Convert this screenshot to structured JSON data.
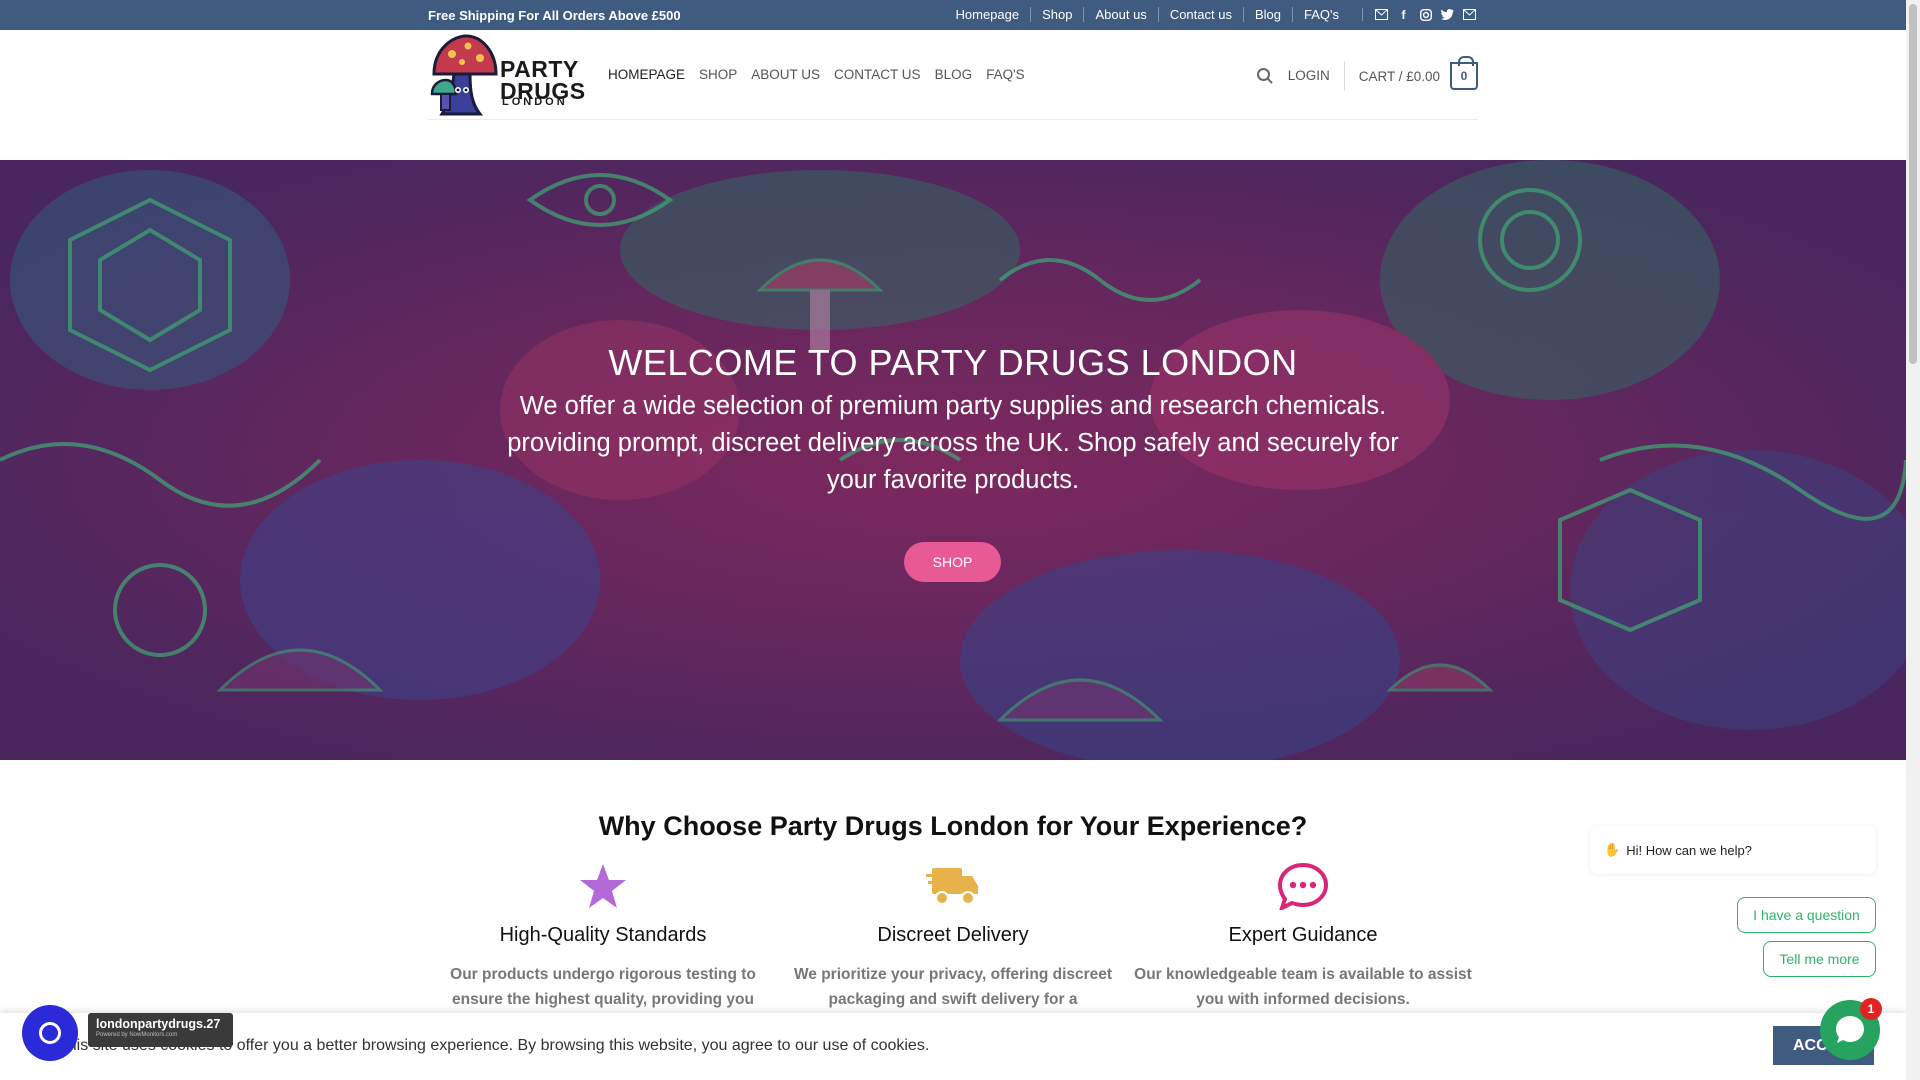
{
  "topbar": {
    "shipping": "Free Shipping For All Orders Above £500",
    "links": [
      "Homepage",
      "Shop",
      "About us",
      "Contact us",
      "Blog",
      "FAQ's"
    ],
    "social_icons": [
      "mail-icon",
      "facebook-icon",
      "instagram-icon",
      "twitter-icon",
      "mail-icon"
    ]
  },
  "header": {
    "logo_line1": "PARTY",
    "logo_line2": "DRUGS",
    "logo_line3": "LONDON",
    "nav": [
      "HOMEPAGE",
      "SHOP",
      "ABOUT US",
      "CONTACT US",
      "BLOG",
      "FAQ'S"
    ],
    "login": "LOGIN",
    "cart": "CART / £0.00",
    "cart_count": "0"
  },
  "hero": {
    "title": "WELCOME TO PARTY DRUGS LONDON",
    "text": "We offer a wide selection of premium party supplies and research chemicals. providing prompt, discreet delivery across the UK. Shop safely and securely for your favorite products.",
    "button": "SHOP"
  },
  "features": {
    "heading": "Why Choose Party Drugs London for Your Experience?",
    "items": [
      {
        "icon": "star-icon",
        "title": "High-Quality Standards",
        "text": "Our products undergo rigorous testing to ensure the highest quality, providing you"
      },
      {
        "icon": "delivery-truck-icon",
        "title": "Discreet Delivery",
        "text": "We prioritize your privacy, offering discreet packaging and swift delivery for a"
      },
      {
        "icon": "chat-bubble-icon",
        "title": "Expert Guidance",
        "text": "Our knowledgeable team is available to assist you with informed decisions."
      }
    ]
  },
  "cookie": {
    "message": "This site uses cookies to offer you a better browsing experience. By browsing this website, you agree to our use of cookies.",
    "accept": "ACCEPT"
  },
  "badge": {
    "name": "londonpartydrugs.27",
    "powered": "Powered by NowMonitors.com"
  },
  "chat": {
    "greeting": "Hi! How can we help?",
    "option1": "I have a question",
    "option2": "Tell me more",
    "unread": "1"
  },
  "colors": {
    "topbar": "#3f5b80",
    "accent_pink": "#e85a93",
    "whatsapp_green": "#25a35f"
  }
}
